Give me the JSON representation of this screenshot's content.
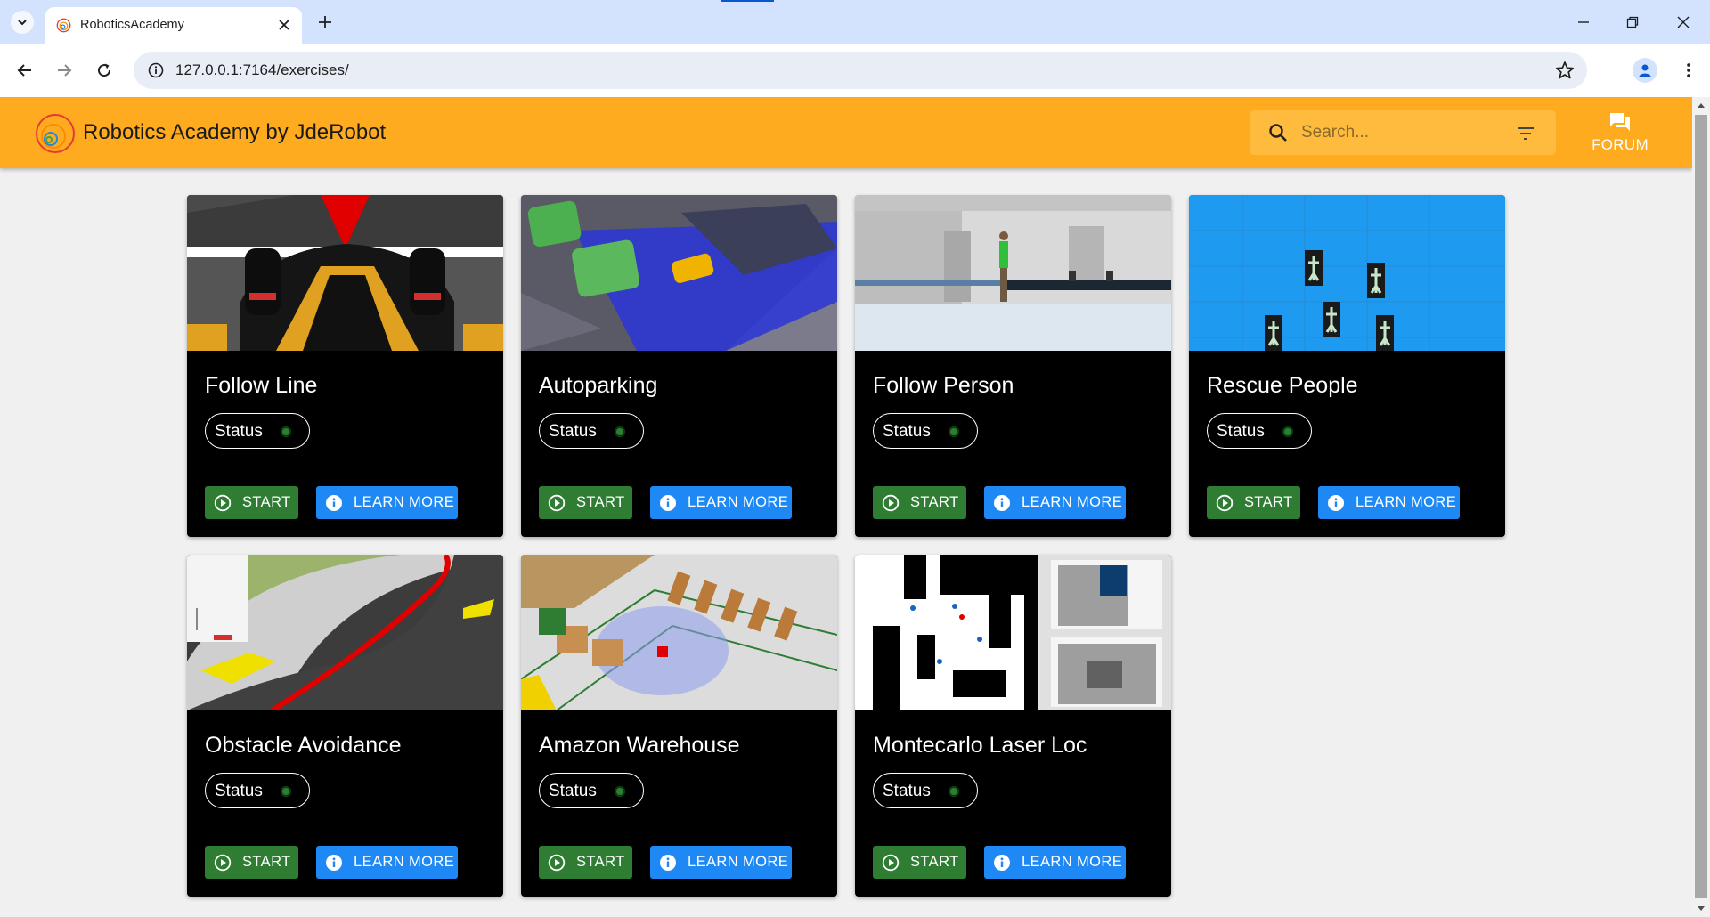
{
  "browser": {
    "tab_title": "RoboticsAcademy",
    "url": "127.0.0.1:7164/exercises/"
  },
  "app": {
    "title": "Robotics Academy by JdeRobot",
    "search_placeholder": "Search...",
    "forum_label": "FORUM",
    "accent_color": "#ffab1f"
  },
  "cards": [
    {
      "title": "Follow Line",
      "status": "Status",
      "start": "START",
      "learn": "LEARN MORE",
      "image": "f1-car-follow-line"
    },
    {
      "title": "Autoparking",
      "status": "Status",
      "start": "START",
      "learn": "LEARN MORE",
      "image": "cars-parking-lidar"
    },
    {
      "title": "Follow Person",
      "status": "Status",
      "start": "START",
      "learn": "LEARN MORE",
      "image": "hospital-corridor-person"
    },
    {
      "title": "Rescue People",
      "status": "Status",
      "start": "START",
      "learn": "LEARN MORE",
      "image": "blue-sea-people-markers"
    },
    {
      "title": "Obstacle Avoidance",
      "status": "Status",
      "start": "START",
      "learn": "LEARN MORE",
      "image": "f1-track-red-line"
    },
    {
      "title": "Amazon Warehouse",
      "status": "Status",
      "start": "START",
      "learn": "LEARN MORE",
      "image": "warehouse-shelves-robot"
    },
    {
      "title": "Montecarlo Laser Loc",
      "status": "Status",
      "start": "START",
      "learn": "LEARN MORE",
      "image": "occupancy-map-particles"
    }
  ],
  "colors": {
    "start_button": "#2e7d32",
    "learn_button": "#1e88f5",
    "status_dot": "#2e7d32"
  }
}
